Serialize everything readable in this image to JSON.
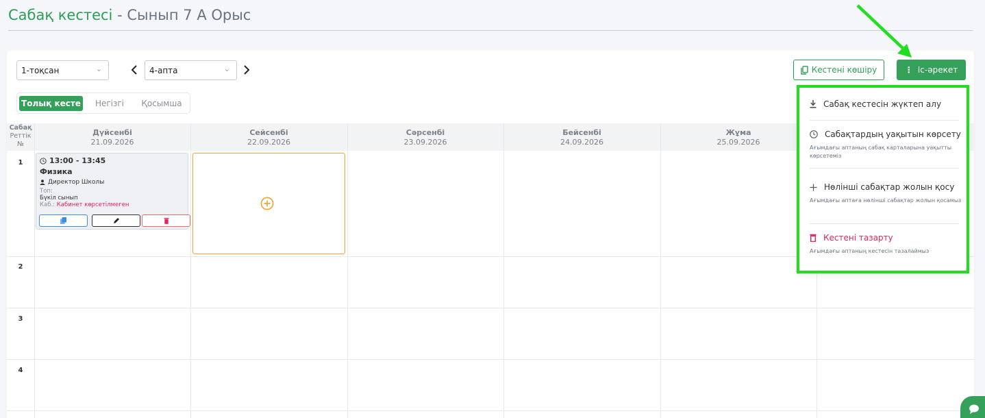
{
  "title": {
    "main": "Сабақ кестесі",
    "sub": " - Сынып 7 А Орыс"
  },
  "filters": {
    "quarter": "1-тоқсан",
    "week": "4-апта"
  },
  "buttons": {
    "copy": "Кестені көшіру",
    "action": "Іс-әрекет"
  },
  "tabs": [
    "Толық кесте",
    "Негізгі",
    "Қосымша"
  ],
  "grid": {
    "num_header": [
      "Сабақ",
      "Реттік",
      "№"
    ],
    "days": [
      {
        "name": "Дүйсенбі",
        "date": "21.09.2026"
      },
      {
        "name": "Сейсенбі",
        "date": "22.09.2026"
      },
      {
        "name": "Сәрсенбі",
        "date": "23.09.2026"
      },
      {
        "name": "Бейсенбі",
        "date": "24.09.2026"
      },
      {
        "name": "Жұма",
        "date": "25.09.2026"
      }
    ],
    "rows": [
      "1",
      "2",
      "3",
      "4"
    ]
  },
  "lesson": {
    "time": "13:00 - 13:45",
    "subject": "Физика",
    "teacher": "Директор Школы",
    "group_label": "Топ:",
    "group_value": "Бүкіл сынып",
    "room_label": "Каб.:",
    "room_value": "Кабинет көрсетілмеген"
  },
  "dropdown": {
    "download": "Сабақ кестесін жүктеп алу",
    "show_time": "Сабақтардың уақытын көрсету",
    "show_time_desc": "Ағымдағы аптаның сабақ карталарына уақытты көрсетеміз",
    "add_zero": "Нөлінші сабақтар жолын қосу",
    "add_zero_desc": "Ағымдағы аптаға нөлінші сабақтар жолын қосамыз",
    "clear": "Кестені тазарту",
    "clear_desc": "Ағымдағы аптаның кестесін тазалаймыз"
  },
  "colors": {
    "accent": "#34a05a",
    "danger": "#e0245e",
    "highlight": "#22dd22",
    "slot": "#f0a43a"
  }
}
